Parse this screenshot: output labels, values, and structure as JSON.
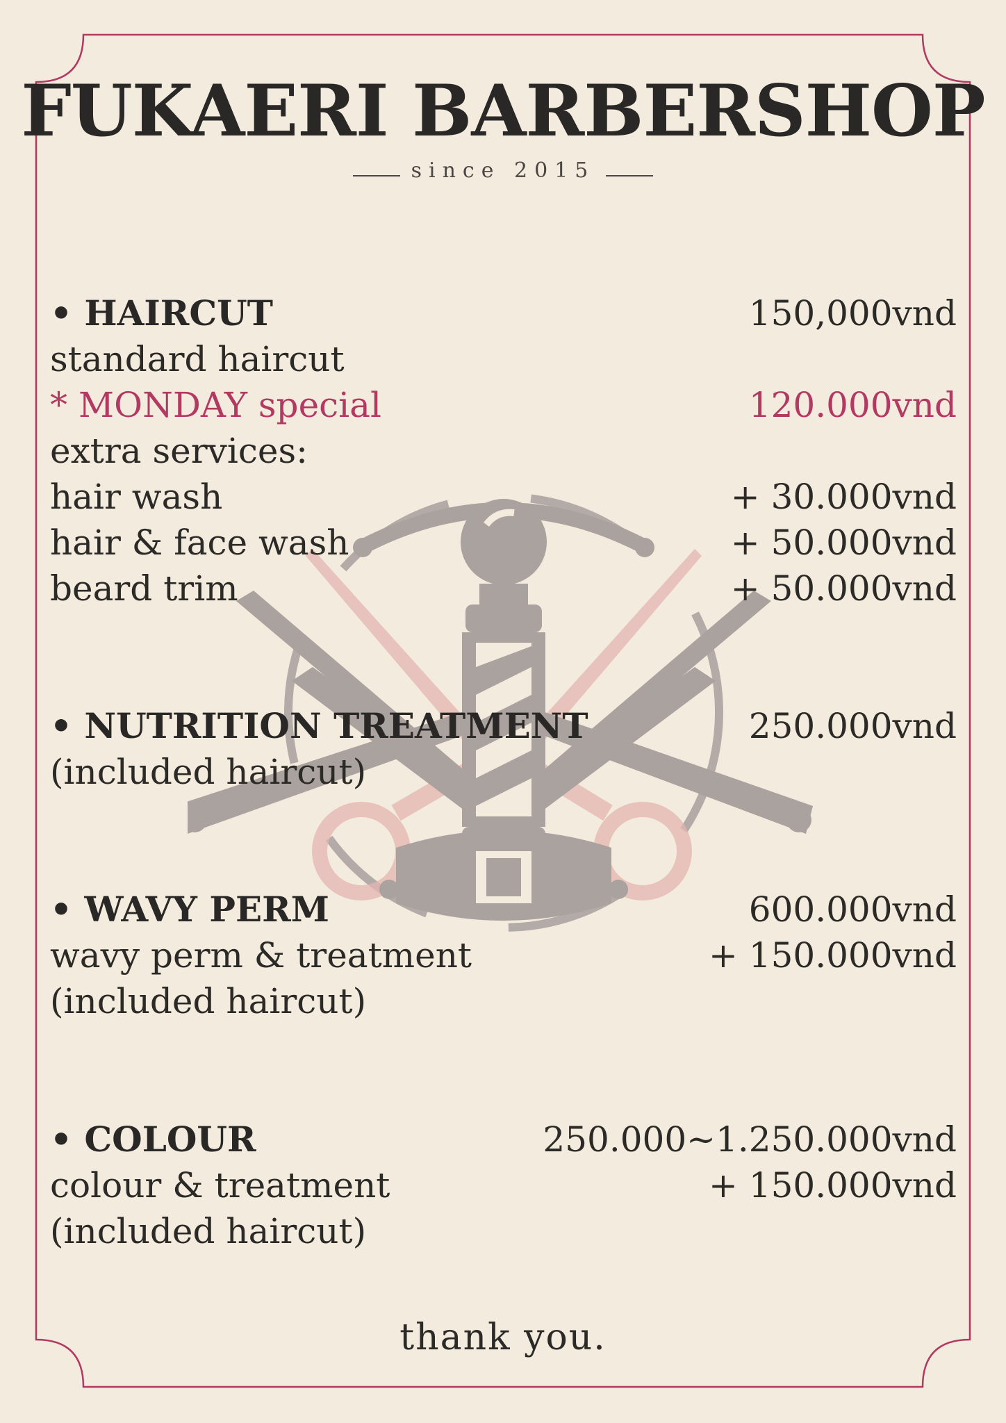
{
  "header": {
    "title": "FUKAERI BARBERSHOP",
    "since": "since 2015"
  },
  "haircut": {
    "name": "• HAIRCUT",
    "price": "150,000vnd",
    "desc": "standard haircut",
    "special_label": "* MONDAY special",
    "special_price": "120.000vnd",
    "extras_label": "extra services:",
    "extras": [
      {
        "label": "hair wash",
        "price": "+ 30.000vnd"
      },
      {
        "label": "hair & face wash",
        "price": "+ 50.000vnd"
      },
      {
        "label": "beard trim",
        "price": "+ 50.000vnd"
      }
    ]
  },
  "nutrition": {
    "name": "• NUTRITION TREATMENT",
    "price": "250.000vnd",
    "note": "(included haircut)"
  },
  "perm": {
    "name": "• WAVY PERM",
    "price": "600.000vnd",
    "desc": "wavy perm & treatment",
    "desc_price": "+ 150.000vnd",
    "note": "(included haircut)"
  },
  "colour": {
    "name": "• COLOUR",
    "price": "250.000~1.250.000vnd",
    "desc": "colour & treatment",
    "desc_price": "+ 150.000vnd",
    "note": "(included haircut)"
  },
  "footer": {
    "thanks": "thank you."
  },
  "colors": {
    "background": "#f3ebdd",
    "frame": "#b23a62",
    "text": "#2c2a27",
    "accent": "#b23a62",
    "emblem_gray": "#aaa29e",
    "emblem_pink": "#e4b6b2"
  },
  "emblem": {
    "icon": "barber-pole-scissors-razors-emblem"
  }
}
